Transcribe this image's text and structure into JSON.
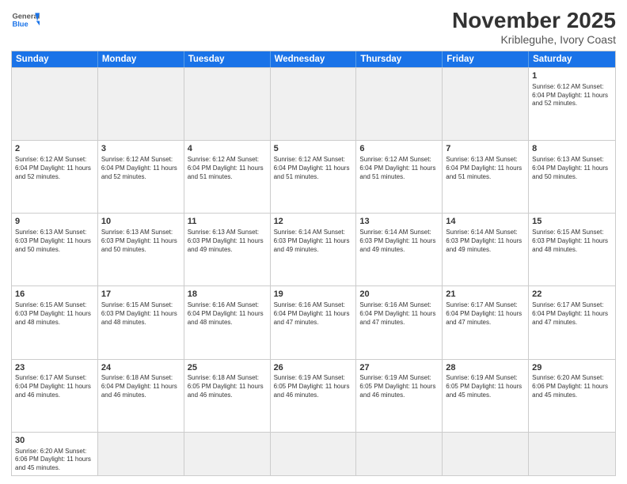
{
  "header": {
    "logo_general": "General",
    "logo_blue": "Blue",
    "title": "November 2025",
    "subtitle": "Kribleguhe, Ivory Coast"
  },
  "dayHeaders": [
    "Sunday",
    "Monday",
    "Tuesday",
    "Wednesday",
    "Thursday",
    "Friday",
    "Saturday"
  ],
  "weeks": [
    [
      {
        "day": "",
        "info": ""
      },
      {
        "day": "",
        "info": ""
      },
      {
        "day": "",
        "info": ""
      },
      {
        "day": "",
        "info": ""
      },
      {
        "day": "",
        "info": ""
      },
      {
        "day": "",
        "info": ""
      },
      {
        "day": "1",
        "info": "Sunrise: 6:12 AM\nSunset: 6:04 PM\nDaylight: 11 hours\nand 52 minutes."
      }
    ],
    [
      {
        "day": "2",
        "info": "Sunrise: 6:12 AM\nSunset: 6:04 PM\nDaylight: 11 hours\nand 52 minutes."
      },
      {
        "day": "3",
        "info": "Sunrise: 6:12 AM\nSunset: 6:04 PM\nDaylight: 11 hours\nand 52 minutes."
      },
      {
        "day": "4",
        "info": "Sunrise: 6:12 AM\nSunset: 6:04 PM\nDaylight: 11 hours\nand 51 minutes."
      },
      {
        "day": "5",
        "info": "Sunrise: 6:12 AM\nSunset: 6:04 PM\nDaylight: 11 hours\nand 51 minutes."
      },
      {
        "day": "6",
        "info": "Sunrise: 6:12 AM\nSunset: 6:04 PM\nDaylight: 11 hours\nand 51 minutes."
      },
      {
        "day": "7",
        "info": "Sunrise: 6:13 AM\nSunset: 6:04 PM\nDaylight: 11 hours\nand 51 minutes."
      },
      {
        "day": "8",
        "info": "Sunrise: 6:13 AM\nSunset: 6:04 PM\nDaylight: 11 hours\nand 50 minutes."
      }
    ],
    [
      {
        "day": "9",
        "info": "Sunrise: 6:13 AM\nSunset: 6:03 PM\nDaylight: 11 hours\nand 50 minutes."
      },
      {
        "day": "10",
        "info": "Sunrise: 6:13 AM\nSunset: 6:03 PM\nDaylight: 11 hours\nand 50 minutes."
      },
      {
        "day": "11",
        "info": "Sunrise: 6:13 AM\nSunset: 6:03 PM\nDaylight: 11 hours\nand 49 minutes."
      },
      {
        "day": "12",
        "info": "Sunrise: 6:14 AM\nSunset: 6:03 PM\nDaylight: 11 hours\nand 49 minutes."
      },
      {
        "day": "13",
        "info": "Sunrise: 6:14 AM\nSunset: 6:03 PM\nDaylight: 11 hours\nand 49 minutes."
      },
      {
        "day": "14",
        "info": "Sunrise: 6:14 AM\nSunset: 6:03 PM\nDaylight: 11 hours\nand 49 minutes."
      },
      {
        "day": "15",
        "info": "Sunrise: 6:15 AM\nSunset: 6:03 PM\nDaylight: 11 hours\nand 48 minutes."
      }
    ],
    [
      {
        "day": "16",
        "info": "Sunrise: 6:15 AM\nSunset: 6:03 PM\nDaylight: 11 hours\nand 48 minutes."
      },
      {
        "day": "17",
        "info": "Sunrise: 6:15 AM\nSunset: 6:03 PM\nDaylight: 11 hours\nand 48 minutes."
      },
      {
        "day": "18",
        "info": "Sunrise: 6:16 AM\nSunset: 6:04 PM\nDaylight: 11 hours\nand 48 minutes."
      },
      {
        "day": "19",
        "info": "Sunrise: 6:16 AM\nSunset: 6:04 PM\nDaylight: 11 hours\nand 47 minutes."
      },
      {
        "day": "20",
        "info": "Sunrise: 6:16 AM\nSunset: 6:04 PM\nDaylight: 11 hours\nand 47 minutes."
      },
      {
        "day": "21",
        "info": "Sunrise: 6:17 AM\nSunset: 6:04 PM\nDaylight: 11 hours\nand 47 minutes."
      },
      {
        "day": "22",
        "info": "Sunrise: 6:17 AM\nSunset: 6:04 PM\nDaylight: 11 hours\nand 47 minutes."
      }
    ],
    [
      {
        "day": "23",
        "info": "Sunrise: 6:17 AM\nSunset: 6:04 PM\nDaylight: 11 hours\nand 46 minutes."
      },
      {
        "day": "24",
        "info": "Sunrise: 6:18 AM\nSunset: 6:04 PM\nDaylight: 11 hours\nand 46 minutes."
      },
      {
        "day": "25",
        "info": "Sunrise: 6:18 AM\nSunset: 6:05 PM\nDaylight: 11 hours\nand 46 minutes."
      },
      {
        "day": "26",
        "info": "Sunrise: 6:19 AM\nSunset: 6:05 PM\nDaylight: 11 hours\nand 46 minutes."
      },
      {
        "day": "27",
        "info": "Sunrise: 6:19 AM\nSunset: 6:05 PM\nDaylight: 11 hours\nand 46 minutes."
      },
      {
        "day": "28",
        "info": "Sunrise: 6:19 AM\nSunset: 6:05 PM\nDaylight: 11 hours\nand 45 minutes."
      },
      {
        "day": "29",
        "info": "Sunrise: 6:20 AM\nSunset: 6:06 PM\nDaylight: 11 hours\nand 45 minutes."
      }
    ],
    [
      {
        "day": "30",
        "info": "Sunrise: 6:20 AM\nSunset: 6:06 PM\nDaylight: 11 hours\nand 45 minutes."
      },
      {
        "day": "",
        "info": ""
      },
      {
        "day": "",
        "info": ""
      },
      {
        "day": "",
        "info": ""
      },
      {
        "day": "",
        "info": ""
      },
      {
        "day": "",
        "info": ""
      },
      {
        "day": "",
        "info": ""
      }
    ]
  ]
}
